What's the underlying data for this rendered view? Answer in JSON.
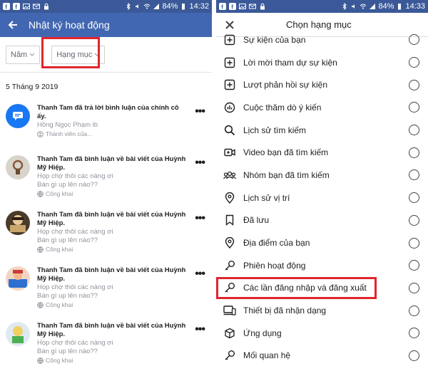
{
  "status_left": {
    "icons": [
      "facebook-icon",
      "facebook-icon",
      "image-icon",
      "mail-icon",
      "lock-icon"
    ],
    "battery": "84%",
    "time": "14:32"
  },
  "status_right": {
    "icons": [
      "facebook-icon",
      "facebook-icon",
      "image-icon",
      "mail-icon",
      "lock-icon"
    ],
    "battery": "84%",
    "time": "14:33"
  },
  "left": {
    "title": "Nhật ký hoạt động",
    "filters": {
      "year": "Năm",
      "category": "Hạng mục"
    },
    "date": "5 Tháng 9 2019",
    "items": [
      {
        "headline": "Thanh Tam đã trả lời bình luận của chính cô ấy.",
        "sub1": "Hồng Ngọc Phạm ib",
        "sub2": "",
        "privacy": "Thành viên của..."
      },
      {
        "headline": "Thanh Tam đã bình luận về bài viết của Huỳnh Mỹ Hiệp.",
        "sub1": "Họp chợ thôi các nàng ơi",
        "sub2": "Bán gì up lên nào??",
        "privacy": "Công khai"
      },
      {
        "headline": "Thanh Tam đã bình luận về bài viết của Huỳnh Mỹ Hiệp.",
        "sub1": "Họp chợ thôi các nàng ơi",
        "sub2": "Bán gì up lên nào??",
        "privacy": "Công khai"
      },
      {
        "headline": "Thanh Tam đã bình luận về bài viết của Huỳnh Mỹ Hiệp.",
        "sub1": "Họp chợ thôi các nàng ơi",
        "sub2": "Bán gì up lên nào??",
        "privacy": "Công khai"
      },
      {
        "headline": "Thanh Tam đã bình luận về bài viết của Huỳnh Mỹ Hiệp.",
        "sub1": "Họp chợ thôi các nàng ơi",
        "sub2": "Bán gì up lên nào??",
        "privacy": "Công khai"
      }
    ]
  },
  "right": {
    "title": "Chọn hạng mục",
    "categories": [
      {
        "label": "Sự kiện của bạn",
        "icon": "add-event-icon"
      },
      {
        "label": "Lời mời tham dự sự kiện",
        "icon": "add-event-icon"
      },
      {
        "label": "Lượt phản hồi sự kiện",
        "icon": "add-event-icon"
      },
      {
        "label": "Cuộc thăm dò ý kiến",
        "icon": "poll-icon"
      },
      {
        "label": "Lịch sử tìm kiếm",
        "icon": "search-icon"
      },
      {
        "label": "Video bạn đã tìm kiếm",
        "icon": "video-icon"
      },
      {
        "label": "Nhóm bạn đã tìm kiếm",
        "icon": "group-icon"
      },
      {
        "label": "Lịch sử vị trí",
        "icon": "location-icon"
      },
      {
        "label": "Đã lưu",
        "icon": "bookmark-icon"
      },
      {
        "label": "Địa điểm của bạn",
        "icon": "location-icon"
      },
      {
        "label": "Phiên hoạt động",
        "icon": "key-icon"
      },
      {
        "label": "Các lần đăng nhập và đăng xuất",
        "icon": "key-icon"
      },
      {
        "label": "Thiết bị đã nhận dạng",
        "icon": "devices-icon"
      },
      {
        "label": "Ứng dụng",
        "icon": "cube-icon"
      },
      {
        "label": "Mối quan hệ",
        "icon": "key-icon"
      }
    ]
  },
  "colors": {
    "facebook_blue": "#4267b2",
    "status_blue": "#3b5998",
    "highlight_red": "#e0262c"
  }
}
